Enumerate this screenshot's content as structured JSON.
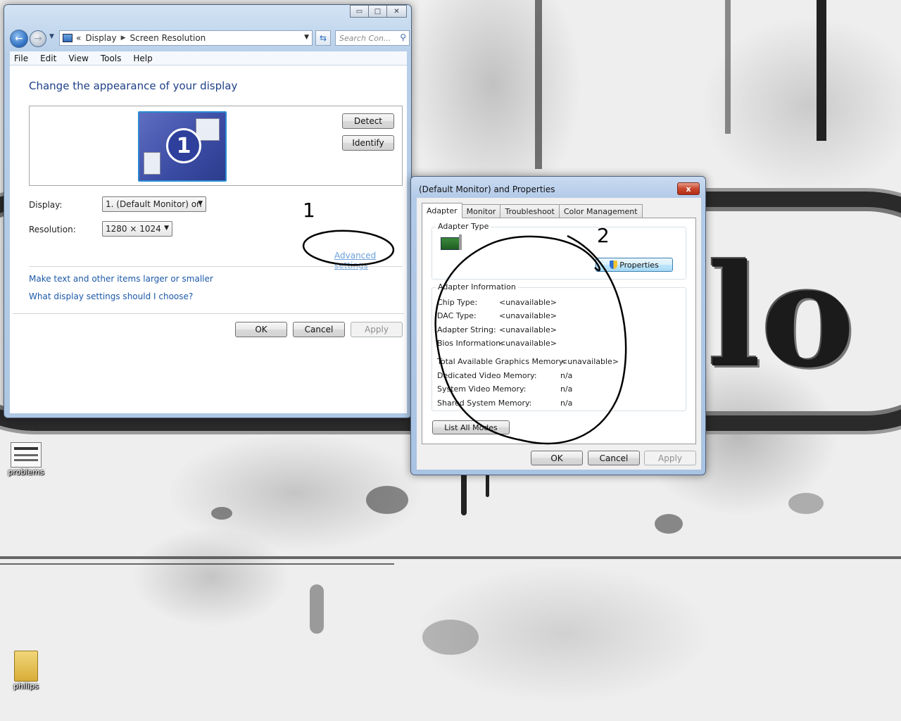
{
  "explorer": {
    "address": {
      "crumb1": "Display",
      "crumb2": "Screen Resolution",
      "overflow": "«"
    },
    "search_placeholder": "Search Con...",
    "menu": [
      "File",
      "Edit",
      "View",
      "Tools",
      "Help"
    ],
    "heading": "Change the appearance of your display",
    "monitor_number": "1",
    "detect_label": "Detect",
    "identify_label": "Identify",
    "display_label": "Display:",
    "display_value": "1. (Default Monitor) on",
    "resolution_label": "Resolution:",
    "resolution_value": "1280 × 1024",
    "advanced_link": "Advanced settings",
    "link_text_size": "Make text and other items larger or smaller",
    "link_help": "What display settings should I choose?",
    "ok": "OK",
    "cancel": "Cancel",
    "apply": "Apply"
  },
  "properties": {
    "title": "(Default Monitor) and  Properties",
    "close": "x",
    "tabs": [
      "Adapter",
      "Monitor",
      "Troubleshoot",
      "Color Management"
    ],
    "adapter_type_title": "Adapter Type",
    "properties_button": "Properties",
    "adapter_info_title": "Adapter Information",
    "info": [
      {
        "label": "Chip Type:",
        "value": "<unavailable>"
      },
      {
        "label": "DAC Type:",
        "value": "<unavailable>"
      },
      {
        "label": "Adapter String:",
        "value": "<unavailable>"
      },
      {
        "label": "Bios Information:",
        "value": "<unavailable>"
      }
    ],
    "memory": [
      {
        "label": "Total Available Graphics Memory:",
        "value": "<unavailable>"
      },
      {
        "label": "Dedicated Video Memory:",
        "value": "n/a"
      },
      {
        "label": "System Video Memory:",
        "value": "n/a"
      },
      {
        "label": "Shared System Memory:",
        "value": "n/a"
      }
    ],
    "list_modes": "List All Modes",
    "ok": "OK",
    "cancel": "Cancel",
    "apply": "Apply"
  },
  "desktop": {
    "icons": [
      {
        "label": "problems"
      },
      {
        "label": "philips"
      }
    ],
    "wallpaper_letters": "lo"
  },
  "annotations": {
    "one": "1",
    "two": "2"
  },
  "colors": {
    "link": "#1b58a8",
    "heading": "#1e3f87",
    "window_frame": "#b7cde8",
    "close_red": "#c8462c"
  }
}
